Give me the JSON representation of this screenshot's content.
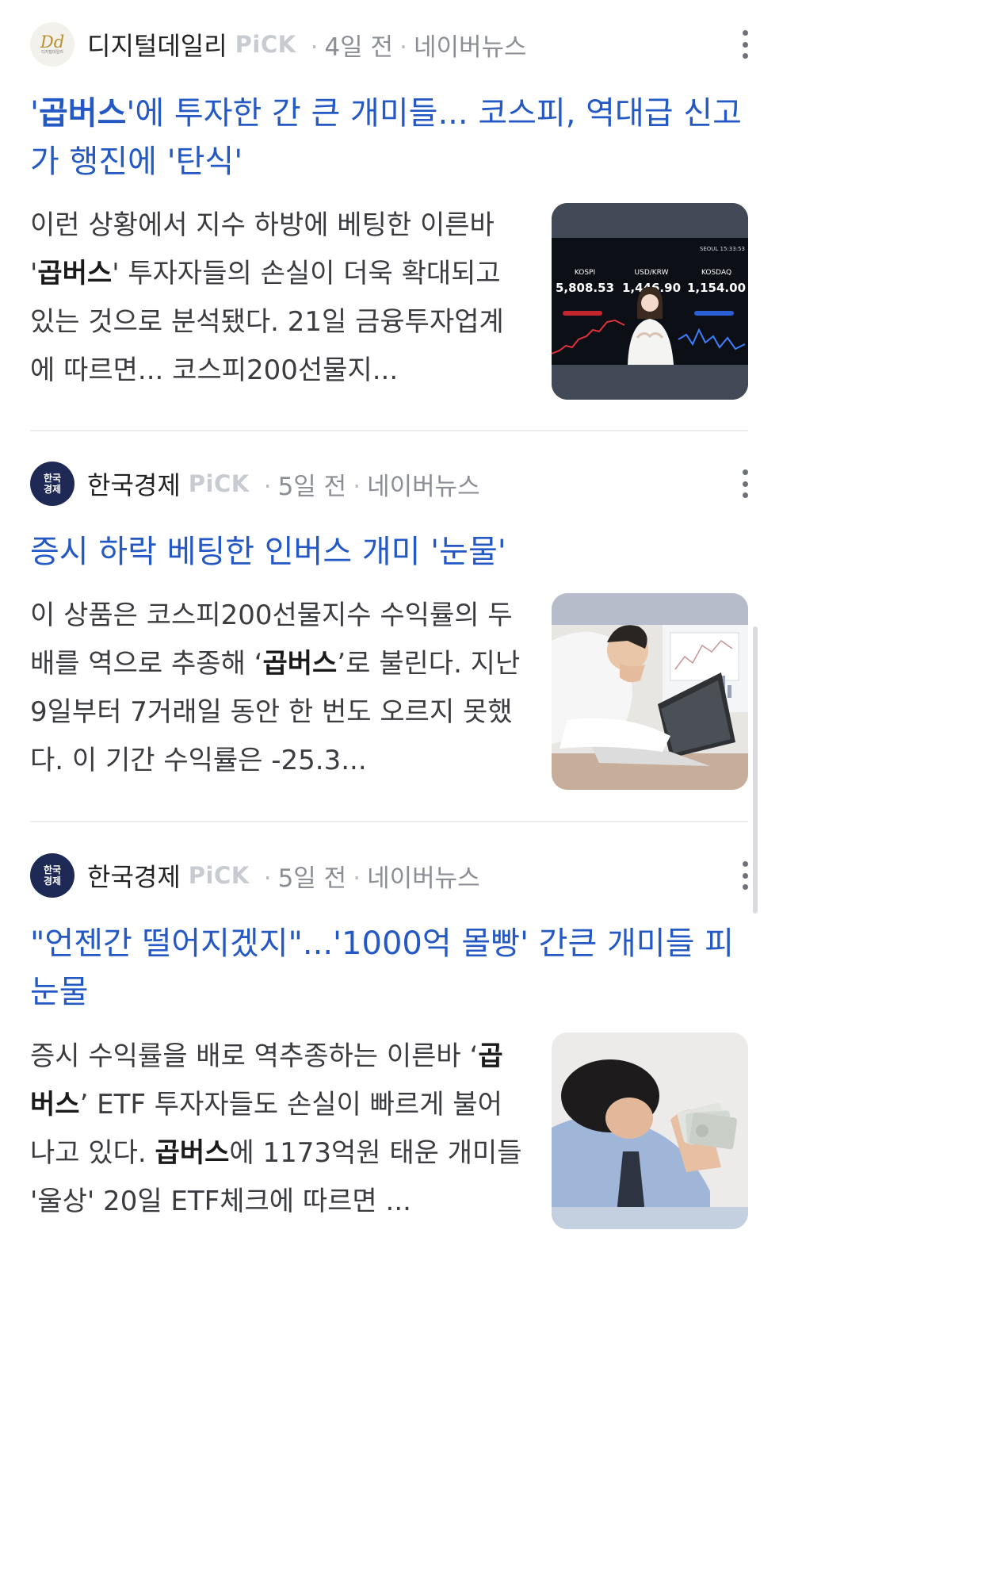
{
  "articles": [
    {
      "source": "디지털데일리",
      "pick": "PiCK",
      "time": "4일 전",
      "platform": "네이버뉴스",
      "headline_pre": "'",
      "headline_bold": "곱버스",
      "headline_post": "'에 투자한 간 큰 개미들... 코스피, 역대급 신고가 행진에 '탄식'",
      "summary_pre": "이런 상황에서 지수 하방에 베팅한 이른바 '",
      "summary_bold": "곱버스",
      "summary_post": "' 투자자들의 손실이 더욱 확대되고 있는 것으로 분석됐다. 21일 금융투자업계에 따르면... 코스피200선물지...",
      "logo_mark": "Dd",
      "logo_sub": "디지털데일리",
      "thumb": {
        "corner": "SEOUL 15:33:53",
        "tickers": [
          {
            "label": "KOSPI",
            "value": "5,808.53"
          },
          {
            "label": "USD/KRW",
            "value": "1,446.90"
          },
          {
            "label": "KOSDAQ",
            "value": "1,154.00"
          }
        ]
      }
    },
    {
      "source": "한국경제",
      "pick": "PiCK",
      "time": "5일 전",
      "platform": "네이버뉴스",
      "headline": "증시 하락 베팅한 인버스 개미 '눈물'",
      "summary_pre": "이 상품은 코스피200선물지수 수익률의 두 배를 역으로 추종해 ‘",
      "summary_bold": "곱버스",
      "summary_post": "’로 불린다. 지난 9일부터 7거래일 동안 한 번도 오르지 못했다. 이 기간 수익률은 -25.3...",
      "logo_line1": "한국",
      "logo_line2": "경제"
    },
    {
      "source": "한국경제",
      "pick": "PiCK",
      "time": "5일 전",
      "platform": "네이버뉴스",
      "headline": "\"언젠간 떨어지겠지\"...'1000억 몰빵' 간큰 개미들 피눈물",
      "summary_a": "증시 수익률을 배로 역추종하는 이른바 ‘",
      "summary_b": "곱버스",
      "summary_c": "’ ETF 투자자들도 손실이 빠르게 불어나고 있다. ",
      "summary_d": "곱버스",
      "summary_e": "에 1173억원 태운 개미들 '울상' 20일 ETF체크에 따르면 ...",
      "logo_line1": "한국",
      "logo_line2": "경제"
    }
  ],
  "colors": {
    "headline": "#2458c4",
    "meta": "#8b8f95",
    "pick": "#c8ccd2",
    "divider": "#eceef0",
    "hk_logo": "#1e2a55"
  }
}
